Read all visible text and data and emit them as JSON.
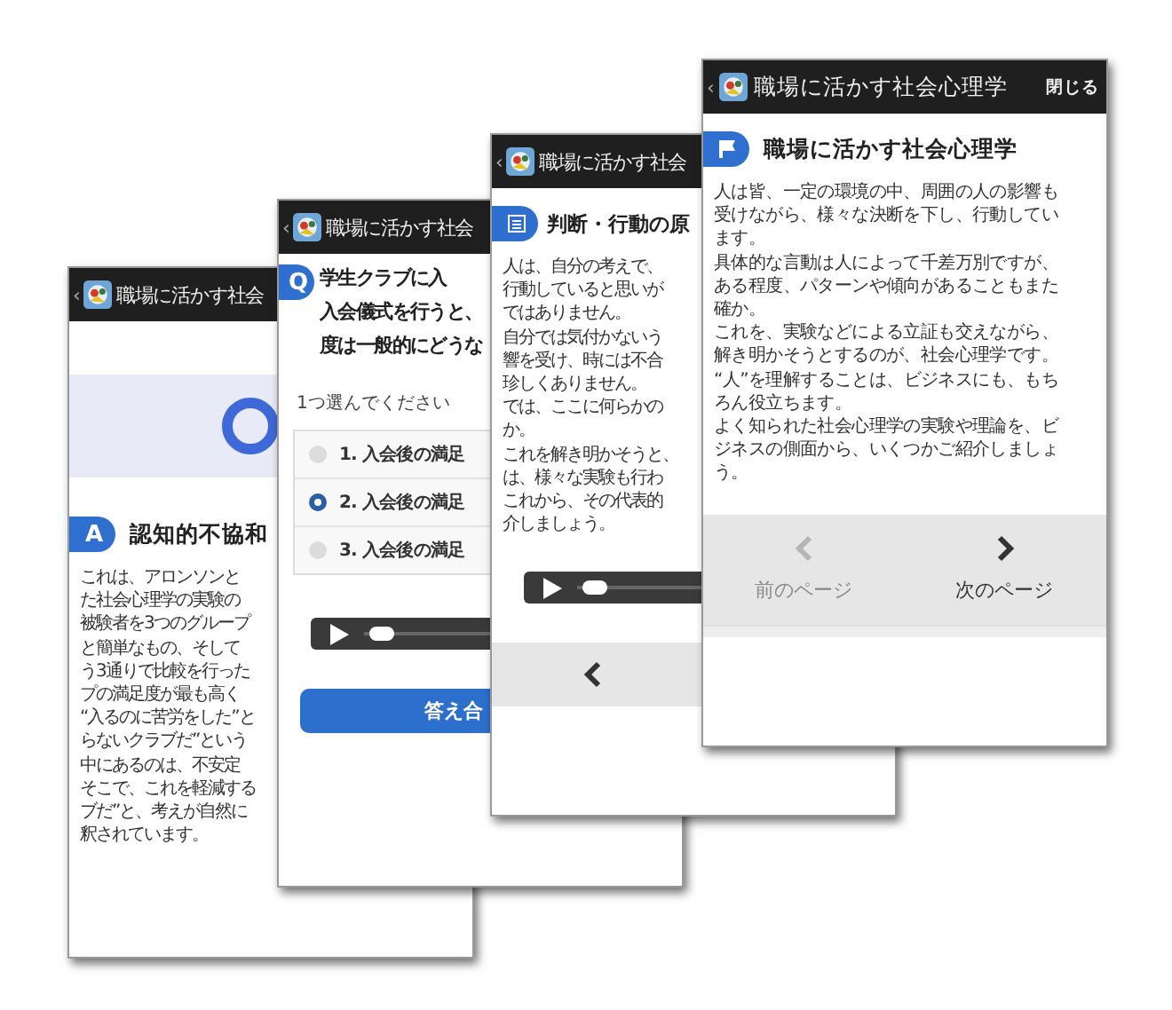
{
  "screens": [
    {
      "header": {
        "back": "‹",
        "title": "職場に活かす社会"
      },
      "blocks": [
        {
          "kind": "hero"
        },
        {
          "kind": "heading",
          "badge": {
            "kind": "letter",
            "text": "A"
          },
          "lines": [
            "認知的不協和"
          ]
        },
        {
          "kind": "paragraph",
          "lines": [
            "これは、アロンソンと",
            "た社会心理学の実験の",
            "被験者を3つのグループ",
            "と簡単なもの、そして",
            "う3通りで比較を行った",
            "プの満足度が最も高く",
            "“入るのに苦労をした”と",
            "らないクラブだ”という",
            "中にあるのは、不安定",
            "そこで、これを軽減する",
            "ブだ”と、考えが自然に",
            "釈されています。"
          ]
        }
      ]
    },
    {
      "header": {
        "back": "‹",
        "title": "職場に活かす社会"
      },
      "blocks": [
        {
          "kind": "heading",
          "badge": {
            "kind": "letter",
            "text": "Q"
          },
          "lines": [
            "学生クラブに入",
            "入会儀式を行うと、",
            "度は一般的にどうな"
          ]
        },
        {
          "kind": "prompt",
          "text": "1つ選んでください"
        },
        {
          "kind": "options",
          "items": [
            {
              "label": "1. 入会後の満足",
              "selected": false
            },
            {
              "label": "2. 入会後の満足",
              "selected": true
            },
            {
              "label": "3. 入会後の満足",
              "selected": false
            }
          ]
        },
        {
          "kind": "audio",
          "level": 0.04
        },
        {
          "kind": "button",
          "label": "答え合"
        }
      ]
    },
    {
      "header": {
        "back": "‹",
        "title": "職場に活かす社会"
      },
      "blocks": [
        {
          "kind": "heading",
          "badge": {
            "kind": "list"
          },
          "lines": [
            "判断・行動の原"
          ]
        },
        {
          "kind": "paragraph",
          "lines": [
            "人は、自分の考えで、",
            "行動していると思いが",
            "ではありません。",
            "自分では気付かないう",
            "響を受け、時には不合",
            "珍しくありません。",
            "では、ここに何らかの",
            "か。",
            "これを解き明かそうと、",
            "は、様々な実験も行わ",
            "これから、その代表的",
            "介しましょう。"
          ]
        },
        {
          "kind": "audio",
          "level": 0.04
        },
        {
          "kind": "nav",
          "items": [
            {
              "kind": "prev",
              "disabled": false
            }
          ]
        }
      ]
    },
    {
      "header": {
        "back": "‹",
        "title": "職場に活かす社会心理学",
        "close": "閉じる"
      },
      "blocks": [
        {
          "kind": "heading",
          "badge": {
            "kind": "flag"
          },
          "lines": [
            "職場に活かす社会心理学"
          ]
        },
        {
          "kind": "paragraph",
          "lines": [
            "人は皆、一定の環境の中、周囲の人の影響も",
            "受けながら、様々な決断を下し、行動してい",
            "ます。",
            "具体的な言動は人によって千差万別ですが、",
            "ある程度、パターンや傾向があることもまた",
            "確か。",
            "これを、実験などによる立証も交えながら、",
            "解き明かそうとするのが、社会心理学です。",
            "“人”を理解することは、ビジネスにも、もち",
            "ろん役立ちます。",
            "よく知られた社会心理学の実験や理論を、ビ",
            "ジネスの側面から、いくつかご紹介しましょ",
            "う。"
          ]
        },
        {
          "kind": "nav",
          "items": [
            {
              "kind": "prev",
              "label": "前のページ",
              "disabled": true
            },
            {
              "kind": "next",
              "label": "次のページ",
              "disabled": false
            }
          ]
        },
        {
          "kind": "scrollbar"
        }
      ]
    }
  ]
}
